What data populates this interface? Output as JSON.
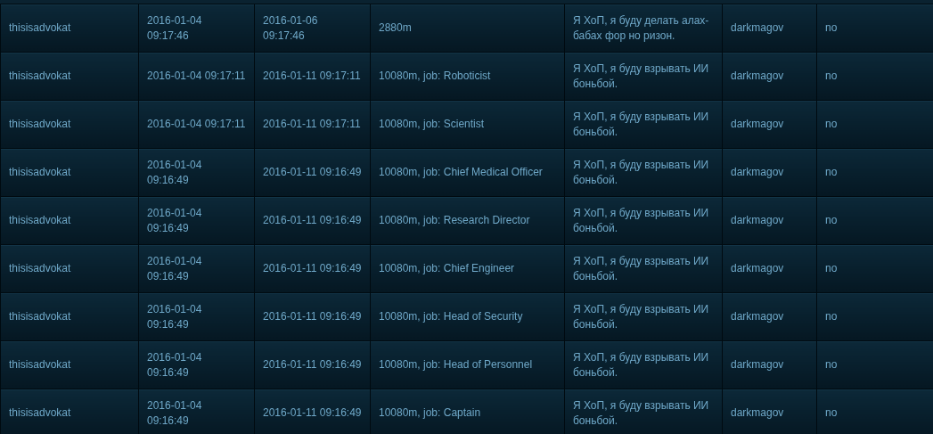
{
  "table": {
    "rows": [
      {
        "cells": [
          "thisisadvokat",
          "2016-01-04 09:17:46",
          "2016-01-06 09:17:46",
          "2880m",
          "Я ХоП, я буду делать алах-бабах фор но ризон.",
          "darkmagov",
          "no"
        ]
      },
      {
        "cells": [
          "thisisadvokat",
          "2016-01-04 09:17:11",
          "2016-01-11 09:17:11",
          "10080m, job: Roboticist",
          "Я ХоП, я буду взрывать ИИ боньбой.",
          "darkmagov",
          "no"
        ]
      },
      {
        "cells": [
          "thisisadvokat",
          "2016-01-04 09:17:11",
          "2016-01-11 09:17:11",
          "10080m, job: Scientist",
          "Я ХоП, я буду взрывать ИИ боньбой.",
          "darkmagov",
          "no"
        ]
      },
      {
        "cells": [
          "thisisadvokat",
          "2016-01-04 09:16:49",
          "2016-01-11 09:16:49",
          "10080m, job: Chief Medical Officer",
          "Я ХоП, я буду взрывать ИИ боньбой.",
          "darkmagov",
          "no"
        ]
      },
      {
        "cells": [
          "thisisadvokat",
          "2016-01-04 09:16:49",
          "2016-01-11 09:16:49",
          "10080m, job: Research Director",
          "Я ХоП, я буду взрывать ИИ боньбой.",
          "darkmagov",
          "no"
        ]
      },
      {
        "cells": [
          "thisisadvokat",
          "2016-01-04 09:16:49",
          "2016-01-11 09:16:49",
          "10080m, job: Chief Engineer",
          "Я ХоП, я буду взрывать ИИ боньбой.",
          "darkmagov",
          "no"
        ]
      },
      {
        "cells": [
          "thisisadvokat",
          "2016-01-04 09:16:49",
          "2016-01-11 09:16:49",
          "10080m, job: Head of Security",
          "Я ХоП, я буду взрывать ИИ боньбой.",
          "darkmagov",
          "no"
        ]
      },
      {
        "cells": [
          "thisisadvokat",
          "2016-01-04 09:16:49",
          "2016-01-11 09:16:49",
          "10080m, job: Head of Personnel",
          "Я ХоП, я буду взрывать ИИ боньбой.",
          "darkmagov",
          "no"
        ]
      },
      {
        "cells": [
          "thisisadvokat",
          "2016-01-04 09:16:49",
          "2016-01-11 09:16:49",
          "10080m, job: Captain",
          "Я ХоП, я буду взрывать ИИ боньбой.",
          "darkmagov",
          "no"
        ]
      }
    ]
  }
}
